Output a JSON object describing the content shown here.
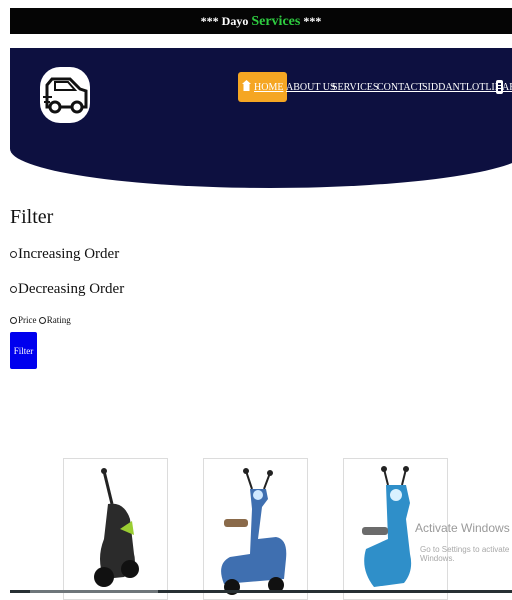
{
  "announcement": {
    "prefix": "*** Dayo",
    "brand": "Services",
    "suffix": " ***"
  },
  "nav": {
    "home": "HOME",
    "about": "ABOUT US",
    "services": "SERVICES",
    "contact": "CONTACT",
    "user": "SIDDANTLOTLIKAR"
  },
  "filter": {
    "title": "Filter",
    "increasing": "Increasing Order",
    "decreasing": "Decreasing Order",
    "price": "Price",
    "rating": "Rating",
    "button": "Filter"
  },
  "products": [
    {
      "name": "black-scooter",
      "color": "#2b2b2b"
    },
    {
      "name": "blue-scooter",
      "color": "#3f6fb0"
    },
    {
      "name": "cyan-scooter",
      "color": "#2f8fc9"
    }
  ],
  "watermark": {
    "title": "Activate Windows",
    "subtitle": "Go to Settings to activate Windows."
  },
  "colors": {
    "hero": "#0d1040",
    "home_active": "#f5a623",
    "filter_button": "#0000ee",
    "brand": "#2ecc40"
  }
}
